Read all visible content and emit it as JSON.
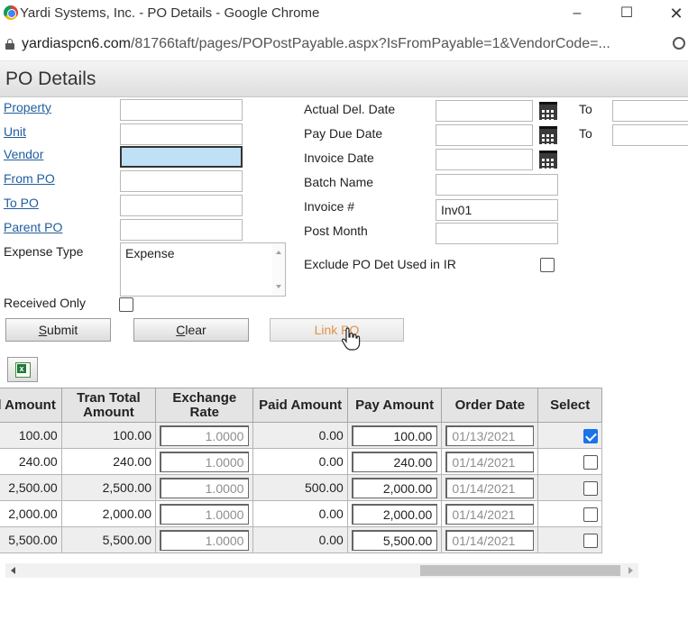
{
  "window": {
    "title": "Yardi Systems, Inc. - PO Details - Google Chrome",
    "minimize": "–",
    "maximize": "☐",
    "close": "✕"
  },
  "address": {
    "host": "yardiaspcn6.com",
    "path": "/81766taft/pages/POPostPayable.aspx?IsFromPayable=1&VendorCode=..."
  },
  "page": {
    "title": "PO Details"
  },
  "form": {
    "property": {
      "label": "Property",
      "value": ""
    },
    "unit": {
      "label": "Unit",
      "value": ""
    },
    "vendor": {
      "label": "Vendor",
      "value": ""
    },
    "from_po": {
      "label": "From PO",
      "value": ""
    },
    "to_po": {
      "label": "To PO",
      "value": ""
    },
    "parent_po": {
      "label": "Parent PO",
      "value": ""
    },
    "expense_type": {
      "label": "Expense Type",
      "value": "Expense"
    },
    "received_only": {
      "label": "Received Only",
      "checked": false
    },
    "actual_del_date": {
      "label": "Actual Del. Date",
      "value": "",
      "to_label": "To",
      "to_value": ""
    },
    "pay_due_date": {
      "label": "Pay Due Date",
      "value": "",
      "to_label": "To",
      "to_value": ""
    },
    "invoice_date": {
      "label": "Invoice Date",
      "value": ""
    },
    "batch_name": {
      "label": "Batch Name",
      "value": ""
    },
    "invoice_no": {
      "label": "Invoice #",
      "value": "Inv01"
    },
    "post_month": {
      "label": "Post Month",
      "value": ""
    },
    "exclude_po": {
      "label": "Exclude PO Det Used in IR",
      "checked": false
    }
  },
  "buttons": {
    "submit_first": "S",
    "submit_rest": "ubmit",
    "clear_first": "C",
    "clear_rest": "lear",
    "link_po": "Link PO"
  },
  "grid": {
    "headers": {
      "total_amount": "Total Amount",
      "tran_total_amount": "Tran Total Amount",
      "exchange_rate": "Exchange Rate",
      "paid_amount": "Paid Amount",
      "pay_amount": "Pay Amount",
      "order_date": "Order Date",
      "select": "Select"
    },
    "rows": [
      {
        "total": "100.00",
        "tran_total": "100.00",
        "exchange_rate": "1.0000",
        "paid": "0.00",
        "pay": "100.00",
        "order_date": "01/13/2021",
        "selected": true
      },
      {
        "total": "240.00",
        "tran_total": "240.00",
        "exchange_rate": "1.0000",
        "paid": "0.00",
        "pay": "240.00",
        "order_date": "01/14/2021",
        "selected": false
      },
      {
        "total": "2,500.00",
        "tran_total": "2,500.00",
        "exchange_rate": "1.0000",
        "paid": "500.00",
        "pay": "2,000.00",
        "order_date": "01/14/2021",
        "selected": false
      },
      {
        "total": "2,000.00",
        "tran_total": "2,000.00",
        "exchange_rate": "1.0000",
        "paid": "0.00",
        "pay": "2,000.00",
        "order_date": "01/14/2021",
        "selected": false
      },
      {
        "total": "5,500.00",
        "tran_total": "5,500.00",
        "exchange_rate": "1.0000",
        "paid": "0.00",
        "pay": "5,500.00",
        "order_date": "01/14/2021",
        "selected": false
      }
    ]
  },
  "icons": {
    "browser": "chrome-icon",
    "lock": "lock-icon",
    "zoom": "zoom-icon",
    "calendar": "calendar-icon",
    "excel": "excel-export-icon",
    "cursor": "hand-cursor-icon"
  },
  "colors": {
    "link": "#1f5e9e",
    "active_field": "#bfe0f5",
    "disabled_button_text": "#e0914a",
    "checkbox_checked": "#1a73e8"
  }
}
